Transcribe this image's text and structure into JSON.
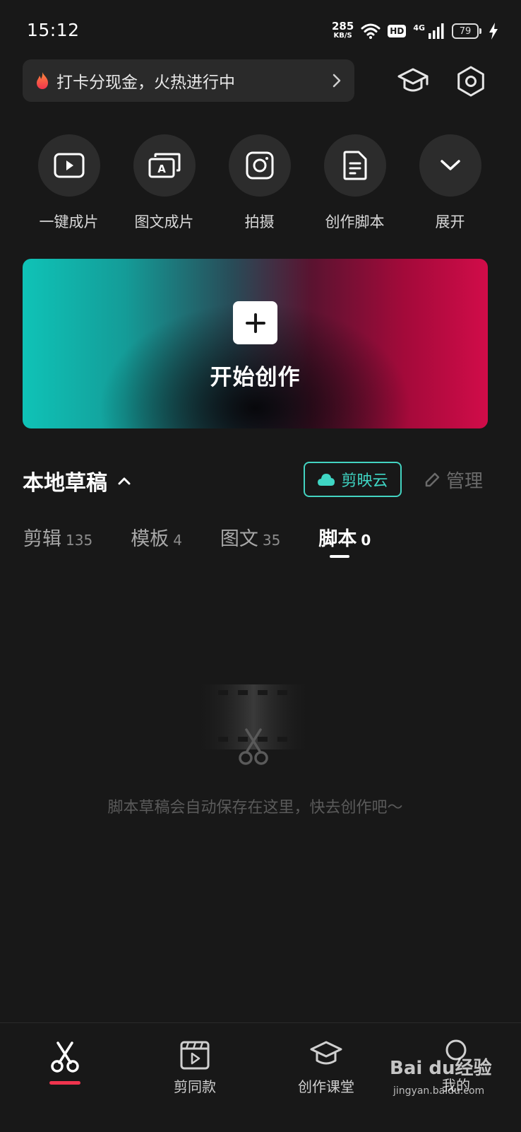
{
  "status_bar": {
    "time": "15:12",
    "net_speed": "285",
    "net_unit": "KB/S",
    "hd": "HD",
    "network": "4G",
    "battery": "79"
  },
  "promo": {
    "text": "打卡分现金，火热进行中",
    "icon": "flame-icon"
  },
  "header_icons": [
    "graduation-cap-icon",
    "settings-hexagon-icon"
  ],
  "quick_actions": [
    {
      "label": "一键成片",
      "icon": "play-icon"
    },
    {
      "label": "图文成片",
      "icon": "text-cards-icon"
    },
    {
      "label": "拍摄",
      "icon": "camera-icon"
    },
    {
      "label": "创作脚本",
      "icon": "script-document-icon"
    },
    {
      "label": "展开",
      "icon": "chevron-down-icon"
    }
  ],
  "create": {
    "label": "开始创作",
    "icon": "plus-icon"
  },
  "drafts": {
    "title": "本地草稿",
    "cloud_label": "剪映云",
    "manage_label": "管理"
  },
  "tabs": [
    {
      "label": "剪辑",
      "count": "135"
    },
    {
      "label": "模板",
      "count": "4"
    },
    {
      "label": "图文",
      "count": "35"
    },
    {
      "label": "脚本",
      "count": "0",
      "active": true
    }
  ],
  "empty_state": {
    "message": "脚本草稿会自动保存在这里，快去创作吧～"
  },
  "bottom_nav": [
    {
      "label": "",
      "icon": "scissors-icon",
      "active": true
    },
    {
      "label": "剪同款",
      "icon": "template-clapper-icon"
    },
    {
      "label": "创作课堂",
      "icon": "graduation-cap-icon"
    },
    {
      "label": "我的",
      "icon": "profile-icon"
    }
  ],
  "watermark": {
    "brand": "Bai du经验",
    "url": "jingyan.baidu.com"
  },
  "colors": {
    "background": "#181818",
    "accent_teal": "#3fd6c4",
    "accent_red": "#f0344e"
  }
}
